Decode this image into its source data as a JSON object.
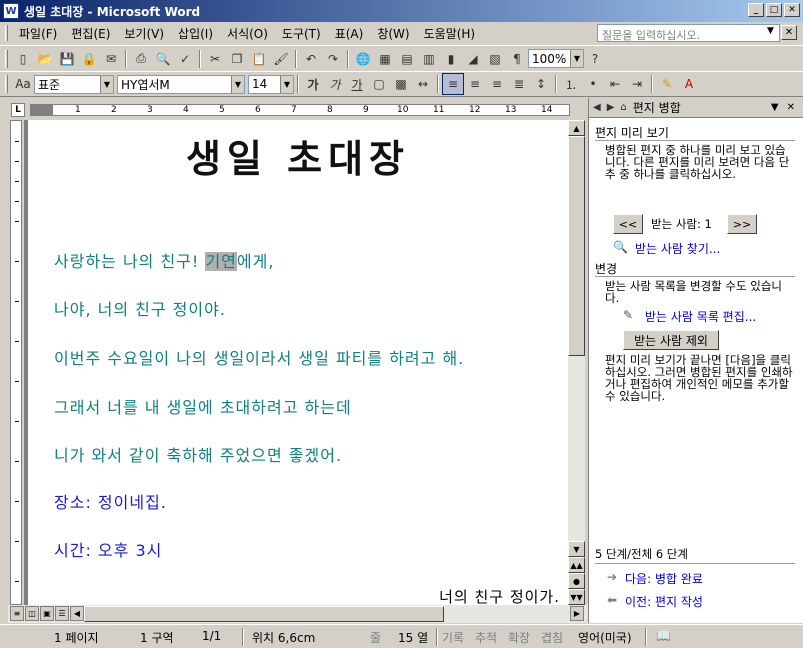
{
  "window": {
    "title": "생일 초대장 - Microsoft Word",
    "icon_label": "W"
  },
  "menu": {
    "items": [
      "파일(F)",
      "편집(E)",
      "보기(V)",
      "삽입(I)",
      "서식(O)",
      "도구(T)",
      "표(A)",
      "창(W)",
      "도움말(H)"
    ]
  },
  "help_box": {
    "placeholder": "질문을 입력하십시오."
  },
  "toolbar": {
    "zoom": "100%",
    "style": "표준",
    "font": "HY엽서M",
    "size": "14",
    "bold": "가",
    "italic": "가",
    "underline": "가"
  },
  "document": {
    "title": "생일 초대장",
    "lines": [
      {
        "pre": "사랑하는 나의 친구! ",
        "highlight": "기연",
        "post": "에게,"
      },
      {
        "text": "나야, 너의 친구 정이야."
      },
      {
        "text": "이번주 수요일이 나의 생일이라서 생일 파티를 하려고 해."
      },
      {
        "text": "그래서 너를 내 생일에 초대하려고 하는데"
      },
      {
        "text": "니가 와서 같이 축하해 주었으면 좋겠어."
      },
      {
        "text": "장소: 정이네집."
      },
      {
        "text": "시간: 오후 3시"
      }
    ],
    "signature": "너의 친구 정이가."
  },
  "taskpane": {
    "title": "편지 병합",
    "preview_section": "편지 미리 보기",
    "preview_text": "병합된 편지 중 하나를 미리 보고 있습니다. 다른 편지를 미리 보려면 다음 단추 중 하나를 클릭하십시오.",
    "prev_btn": "<<",
    "next_btn": ">>",
    "recipient_label": "받는 사람: 1",
    "find_link": "받는 사람 찾기...",
    "change_section": "변경",
    "change_text": "받는 사람 목록을 변경할 수도 있습니다.",
    "edit_link": "받는 사람 목록 편집...",
    "exclude_btn": "받는 사람 제외",
    "finish_text": "편지 미리 보기가 끝나면 [다음]을 클릭하십시오. 그러면 병합된 편지를 인쇄하거나 편집하여 개인적인 메모를 추가할 수 있습니다.",
    "step": "5 단계/전체 6 단계",
    "next_step": "다음: 병합 완료",
    "prev_step": "이전: 편지 작성"
  },
  "status": {
    "page": "1 페이지",
    "section": "1 구역",
    "pages": "1/1",
    "position": "위치 6,6cm",
    "line_label": "줄",
    "col": "15 열",
    "rec": "기록",
    "trk": "추적",
    "ext": "확장",
    "ovr": "겹침",
    "lang": "영어(미국)"
  }
}
